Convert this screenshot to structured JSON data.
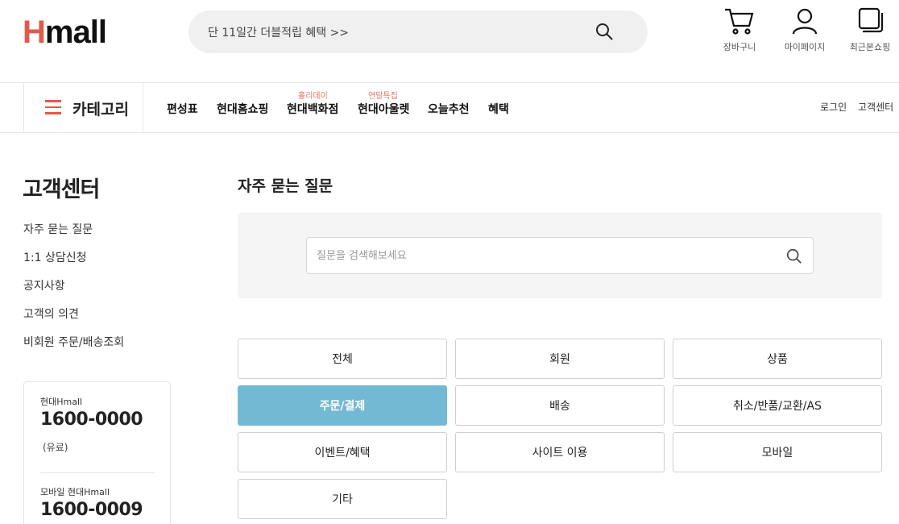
{
  "header": {
    "logo_h": "H",
    "logo_rest": "mall",
    "search_text": "단 11일간 더블적립 혜택 >>",
    "tools": [
      {
        "label": "장바구니",
        "icon": "cart-icon"
      },
      {
        "label": "마이페이지",
        "icon": "user-icon"
      },
      {
        "label": "최근본쇼핑",
        "icon": "recent-icon"
      }
    ]
  },
  "nav": {
    "category_label": "카테고리",
    "items": [
      {
        "label": "편성표",
        "tag": ""
      },
      {
        "label": "현대홈쇼핑",
        "tag": ""
      },
      {
        "label": "현대백화점",
        "tag": "홀리데이"
      },
      {
        "label": "현대아울렛",
        "tag": "연말특집"
      },
      {
        "label": "오늘추천",
        "tag": ""
      },
      {
        "label": "혜택",
        "tag": ""
      }
    ],
    "login": "로그인",
    "customer_center": "고객센터"
  },
  "sidebar": {
    "title": "고객센터",
    "items": [
      "자주 묻는 질문",
      "1:1 상담신청",
      "공지사항",
      "고객의 의견",
      "비회원 주문/배송조회"
    ],
    "contacts": [
      {
        "name": "현대Hmall",
        "number": "1600-0000",
        "note": "(유료)"
      },
      {
        "name": "모바일 현대Hmall",
        "number": "1600-0009"
      }
    ]
  },
  "main": {
    "title": "자주 묻는 질문",
    "search_placeholder": "질문을 검색해보세요",
    "categories": [
      "전체",
      "회원",
      "상품",
      "주문/결제",
      "배송",
      "취소/반품/교환/AS",
      "이벤트/혜택",
      "사이트 이용",
      "모바일",
      "기타"
    ],
    "active_category": "주문/결제"
  },
  "colors": {
    "brand": "#e25a4a",
    "active_button": "#74b9d3",
    "nav_tag": "#e2776a"
  }
}
